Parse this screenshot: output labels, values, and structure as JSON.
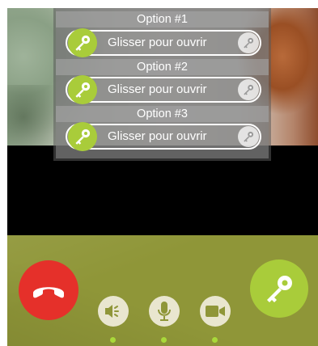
{
  "options": [
    {
      "title": "Option #1",
      "slider_label": "Glisser pour ouvrir"
    },
    {
      "title": "Option #2",
      "slider_label": "Glisser pour ouvrir"
    },
    {
      "title": "Option #3",
      "slider_label": "Glisser pour ouvrir"
    }
  ],
  "controls": {
    "hangup_icon": "phone-hangup-icon",
    "unlock_icon": "key-icon",
    "speaker_icon": "speaker-icon",
    "microphone_icon": "microphone-icon",
    "camera_icon": "video-camera-icon"
  },
  "colors": {
    "accent_green": "#a9cc3a",
    "hangup_red": "#e5302a",
    "bar_olive": "#8f9638",
    "indicator_dot": "#a9d93a"
  }
}
